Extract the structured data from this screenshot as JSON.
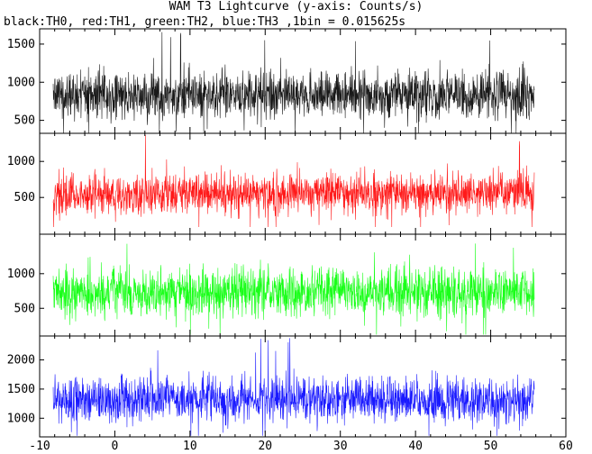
{
  "chart_data": {
    "type": "line",
    "title": "WAM T3 Lightcurve (y-axis: Counts/s)",
    "subtitle": "black:TH0, red:TH1, green:TH2, blue:TH3 ,1bin = 0.015625s",
    "xlabel": "",
    "ylabel": "",
    "xlim": [
      -10,
      60
    ],
    "x_range": [
      -8.2,
      55.8
    ],
    "x_ticks": [
      -10,
      0,
      10,
      20,
      30,
      40,
      50,
      60
    ],
    "grid": false,
    "legend": "none",
    "series": [
      {
        "color": "#000000",
        "ylim": [
          330,
          1700
        ],
        "y_ticks": [
          500,
          1000,
          1500
        ],
        "mean": 830,
        "typical_low": 350,
        "typical_high": 1300,
        "min": 330,
        "max": 1680
      },
      {
        "color": "#ff0000",
        "ylim": [
          -10,
          1390
        ],
        "y_ticks": [
          500,
          1000
        ],
        "mean": 560,
        "typical_low": 150,
        "typical_high": 1000,
        "min": 90,
        "max": 1370
      },
      {
        "color": "#00ff00",
        "ylim": [
          100,
          1570
        ],
        "y_ticks": [
          500,
          1000
        ],
        "mean": 740,
        "typical_low": 250,
        "typical_high": 1250,
        "min": 120,
        "max": 1560
      },
      {
        "color": "#0000ff",
        "ylim": [
          680,
          2410
        ],
        "y_ticks": [
          1000,
          1500,
          2000
        ],
        "mean": 1330,
        "typical_low": 800,
        "typical_high": 1950,
        "min": 700,
        "max": 2390
      }
    ]
  }
}
